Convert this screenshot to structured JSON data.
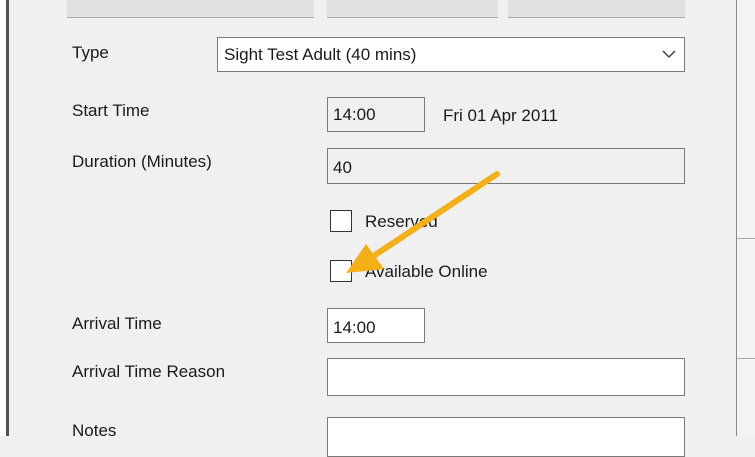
{
  "form": {
    "type_label": "Type",
    "type_value": "Sight Test Adult (40 mins)",
    "start_time_label": "Start Time",
    "start_time_value": "14:00",
    "start_date_text": "Fri 01 Apr 2011",
    "duration_label": "Duration (Minutes)",
    "duration_value": "40",
    "reserved_label": "Reserved",
    "available_online_label": "Available Online",
    "arrival_time_label": "Arrival Time",
    "arrival_time_value": "14:00",
    "arrival_reason_label": "Arrival Time Reason",
    "arrival_reason_value": "",
    "notes_label": "Notes",
    "notes_value": ""
  },
  "icons": {
    "dropdown": "chevron-down-icon",
    "annotation": "arrow-annotation-icon"
  },
  "colors": {
    "annotation_arrow": "#f5b018",
    "readonly_field": "#f0f0f0",
    "window_bg": "#f0f0f0"
  }
}
